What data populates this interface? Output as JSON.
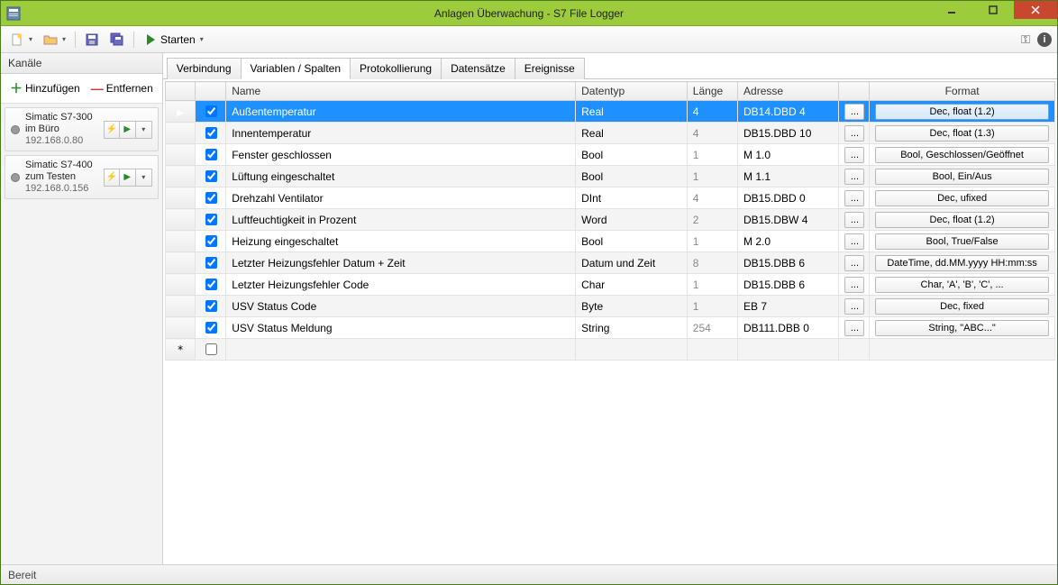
{
  "window": {
    "title": "Anlagen Überwachung - S7 File Logger"
  },
  "toolbar": {
    "start_label": "Starten"
  },
  "sidebar": {
    "header": "Kanäle",
    "add_label": "Hinzufügen",
    "remove_label": "Entfernen",
    "channels": [
      {
        "name": "Simatic S7-300 im Büro",
        "ip": "192.168.0.80"
      },
      {
        "name": "Simatic S7-400 zum Testen",
        "ip": "192.168.0.156"
      }
    ]
  },
  "tabs": {
    "items": [
      "Verbindung",
      "Variablen / Spalten",
      "Protokollierung",
      "Datensätze",
      "Ereignisse"
    ],
    "active_index": 1
  },
  "grid": {
    "columns": {
      "name": "Name",
      "datatype": "Datentyp",
      "length": "Länge",
      "address": "Adresse",
      "format": "Format"
    },
    "ellipsis": "...",
    "rows": [
      {
        "checked": true,
        "name": "Außentemperatur",
        "datatype": "Real",
        "length": "4",
        "address": "DB14.DBD 4",
        "format": "Dec, float (1.2)",
        "selected": true
      },
      {
        "checked": true,
        "name": "Innentemperatur",
        "datatype": "Real",
        "length": "4",
        "address": "DB15.DBD 10",
        "format": "Dec, float (1.3)"
      },
      {
        "checked": true,
        "name": "Fenster geschlossen",
        "datatype": "Bool",
        "length": "1",
        "address": "M 1.0",
        "format": "Bool, Geschlossen/Geöffnet"
      },
      {
        "checked": true,
        "name": "Lüftung eingeschaltet",
        "datatype": "Bool",
        "length": "1",
        "address": "M 1.1",
        "format": "Bool, Ein/Aus"
      },
      {
        "checked": true,
        "name": "Drehzahl Ventilator",
        "datatype": "DInt",
        "length": "4",
        "address": "DB15.DBD 0",
        "format": "Dec, ufixed"
      },
      {
        "checked": true,
        "name": "Luftfeuchtigkeit in Prozent",
        "datatype": "Word",
        "length": "2",
        "address": "DB15.DBW 4",
        "format": "Dec, float (1.2)"
      },
      {
        "checked": true,
        "name": "Heizung eingeschaltet",
        "datatype": "Bool",
        "length": "1",
        "address": "M 2.0",
        "format": "Bool, True/False"
      },
      {
        "checked": true,
        "name": "Letzter Heizungsfehler Datum + Zeit",
        "datatype": "Datum und Zeit",
        "length": "8",
        "address": "DB15.DBB 6",
        "format": "DateTime, dd.MM.yyyy HH:mm:ss"
      },
      {
        "checked": true,
        "name": "Letzter Heizungsfehler Code",
        "datatype": "Char",
        "length": "1",
        "address": "DB15.DBB 6",
        "format": "Char, 'A', 'B', 'C', ..."
      },
      {
        "checked": true,
        "name": "USV Status Code",
        "datatype": "Byte",
        "length": "1",
        "address": "EB 7",
        "format": "Dec, fixed"
      },
      {
        "checked": true,
        "name": "USV Status Meldung",
        "datatype": "String",
        "length": "254",
        "address": "DB111.DBB 0",
        "format": "String, \"ABC...\""
      }
    ]
  },
  "status": {
    "text": "Bereit"
  }
}
